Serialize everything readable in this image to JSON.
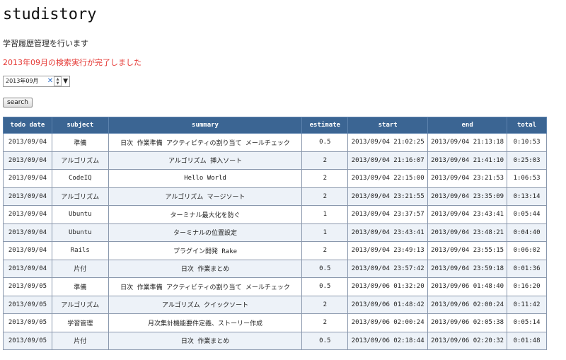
{
  "app": {
    "title": "studistory",
    "description": "学習履歴管理を行います"
  },
  "status": {
    "message": "2013年09月の検索実行が完了しました",
    "color": "#e53935"
  },
  "form": {
    "month_value": "2013年09月",
    "clear_icon": "clear-icon",
    "search_label": "search"
  },
  "table": {
    "headers": [
      "todo date",
      "subject",
      "summary",
      "estimate",
      "start",
      "end",
      "total"
    ],
    "rows": [
      [
        "2013/09/04",
        "準備",
        "日次 作業準備 アクティビティの割り当て メールチェック",
        "0.5",
        "2013/09/04 21:02:25",
        "2013/09/04 21:13:18",
        "0:10:53"
      ],
      [
        "2013/09/04",
        "アルゴリズム",
        "アルゴリズム 挿入ソート",
        "2",
        "2013/09/04 21:16:07",
        "2013/09/04 21:41:10",
        "0:25:03"
      ],
      [
        "2013/09/04",
        "CodeIQ",
        "Hello World",
        "2",
        "2013/09/04 22:15:00",
        "2013/09/04 23:21:53",
        "1:06:53"
      ],
      [
        "2013/09/04",
        "アルゴリズム",
        "アルゴリズム マージソート",
        "2",
        "2013/09/04 23:21:55",
        "2013/09/04 23:35:09",
        "0:13:14"
      ],
      [
        "2013/09/04",
        "Ubuntu",
        "ターミナル最大化を防ぐ",
        "1",
        "2013/09/04 23:37:57",
        "2013/09/04 23:43:41",
        "0:05:44"
      ],
      [
        "2013/09/04",
        "Ubuntu",
        "ターミナルの位置設定",
        "1",
        "2013/09/04 23:43:41",
        "2013/09/04 23:48:21",
        "0:04:40"
      ],
      [
        "2013/09/04",
        "Rails",
        "プラグイン開発 Rake",
        "2",
        "2013/09/04 23:49:13",
        "2013/09/04 23:55:15",
        "0:06:02"
      ],
      [
        "2013/09/04",
        "片付",
        "日次 作業まとめ",
        "0.5",
        "2013/09/04 23:57:42",
        "2013/09/04 23:59:18",
        "0:01:36"
      ],
      [
        "2013/09/05",
        "準備",
        "日次 作業準備 アクティビティの割り当て メールチェック",
        "0.5",
        "2013/09/06 01:32:20",
        "2013/09/06 01:48:40",
        "0:16:20"
      ],
      [
        "2013/09/05",
        "アルゴリズム",
        "アルゴリズム クイックソート",
        "2",
        "2013/09/06 01:48:42",
        "2013/09/06 02:00:24",
        "0:11:42"
      ],
      [
        "2013/09/05",
        "学習管理",
        "月次集計機能要件定義、ストーリー作成",
        "2",
        "2013/09/06 02:00:24",
        "2013/09/06 02:05:38",
        "0:05:14"
      ],
      [
        "2013/09/05",
        "片付",
        "日次 作業まとめ",
        "0.5",
        "2013/09/06 02:18:44",
        "2013/09/06 02:20:32",
        "0:01:48"
      ]
    ]
  }
}
